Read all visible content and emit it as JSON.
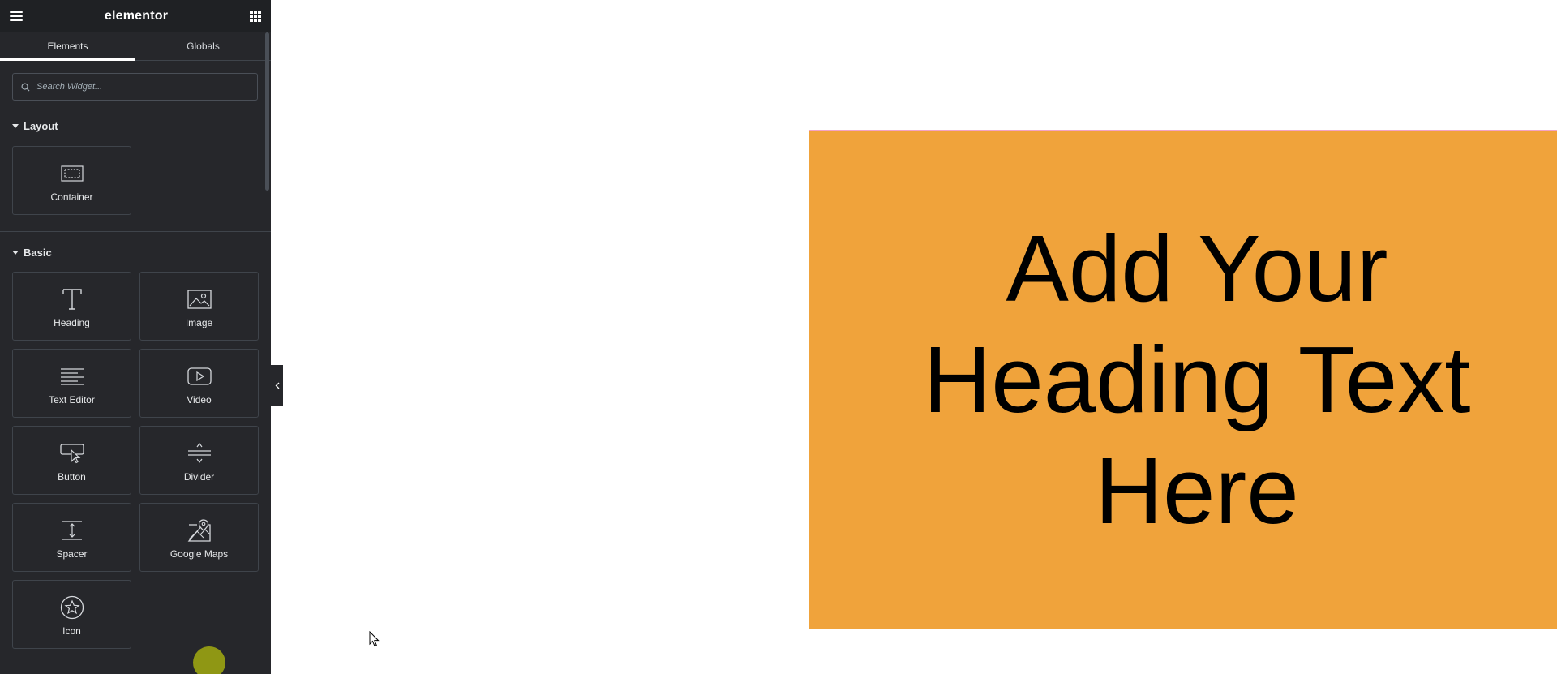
{
  "app": {
    "logo": "elementor"
  },
  "tabs": [
    {
      "label": "Elements",
      "active": true
    },
    {
      "label": "Globals",
      "active": false
    }
  ],
  "search": {
    "placeholder": "Search Widget..."
  },
  "sections": {
    "layout": {
      "title": "Layout",
      "widgets": [
        {
          "label": "Container",
          "icon": "container-icon"
        }
      ]
    },
    "basic": {
      "title": "Basic",
      "widgets": [
        {
          "label": "Heading",
          "icon": "heading-icon"
        },
        {
          "label": "Image",
          "icon": "image-icon"
        },
        {
          "label": "Text Editor",
          "icon": "text-editor-icon"
        },
        {
          "label": "Video",
          "icon": "video-icon"
        },
        {
          "label": "Button",
          "icon": "button-icon"
        },
        {
          "label": "Divider",
          "icon": "divider-icon"
        },
        {
          "label": "Spacer",
          "icon": "spacer-icon"
        },
        {
          "label": "Google Maps",
          "icon": "google-maps-icon"
        },
        {
          "label": "Icon",
          "icon": "star-icon"
        }
      ]
    }
  },
  "canvas": {
    "heading_text": "Add Your Heading Text Here",
    "container_color": "#f0a33b",
    "container_border_color": "#f4a3c6"
  },
  "colors": {
    "sidebar_bg": "#26272b",
    "topbar_bg": "#1f2124",
    "accent_dot": "#8f9714"
  }
}
